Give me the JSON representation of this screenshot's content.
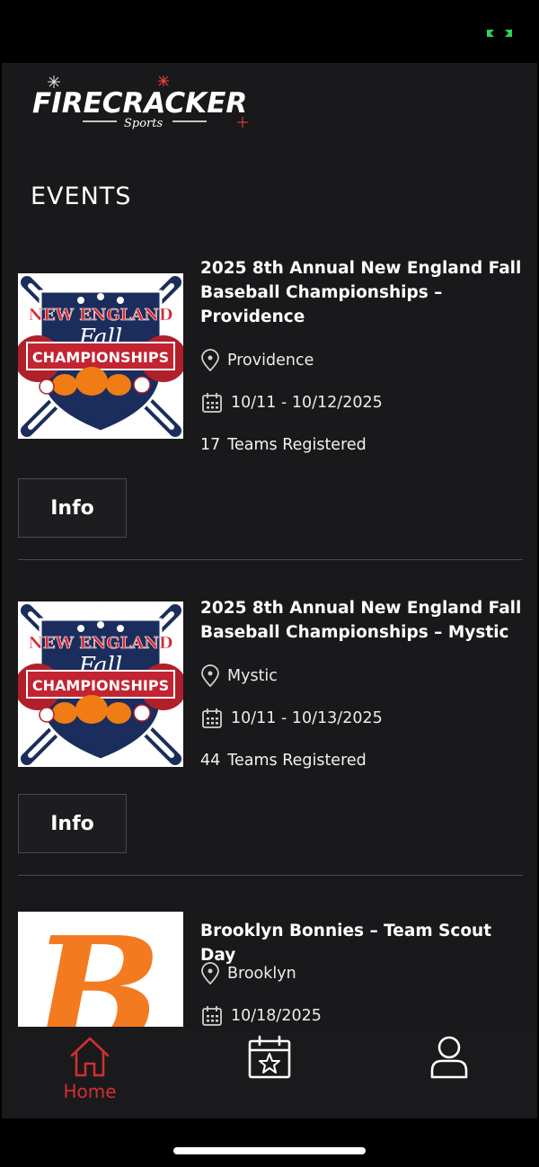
{
  "app": {
    "brand_main": "FIRECRACKER",
    "brand_sub": "Sports",
    "section_title": "EVENTS"
  },
  "colors": {
    "background": "#19191b",
    "accent": "#d03030",
    "battery": "#30d158"
  },
  "events": [
    {
      "title": "2025 8th Annual New England Fall Baseball Championships – Providence",
      "location": "Providence",
      "dates": "10/11 - 10/12/2025",
      "teams_count": "17",
      "teams_label": "Teams Registered",
      "button_label": "Info",
      "logo_top": "NEW ENGLAND",
      "logo_mid": "Fall",
      "logo_banner": "CHAMPIONSHIPS"
    },
    {
      "title": "2025 8th Annual New England Fall Baseball Championships – Mystic",
      "location": "Mystic",
      "dates": "10/11 - 10/13/2025",
      "teams_count": "44",
      "teams_label": "Teams Registered",
      "button_label": "Info",
      "logo_top": "NEW ENGLAND",
      "logo_mid": "Fall",
      "logo_banner": "CHAMPIONSHIPS"
    },
    {
      "title": "Brooklyn Bonnies – Team Scout Day",
      "location": "Brooklyn",
      "dates": "10/18/2025",
      "logo_letter": "B"
    }
  ],
  "nav": {
    "home_label": "Home",
    "items": [
      {
        "icon": "home-icon",
        "active": true
      },
      {
        "icon": "calendar-star-icon",
        "active": false
      },
      {
        "icon": "user-icon",
        "active": false
      }
    ]
  }
}
